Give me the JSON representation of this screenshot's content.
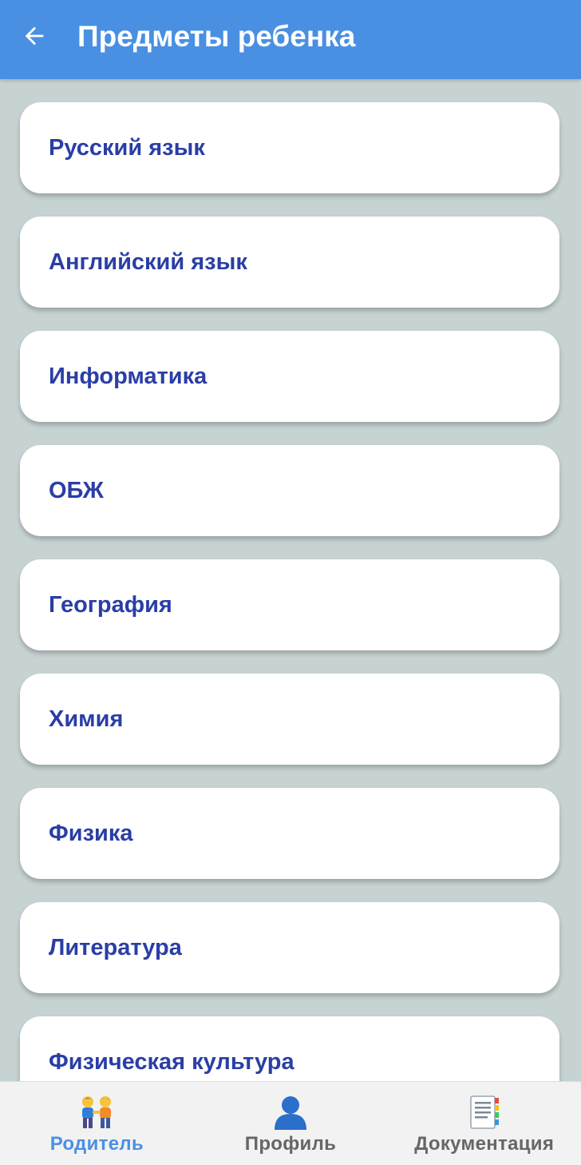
{
  "header": {
    "back_icon": "arrow-left-icon",
    "title": "Предметы ребенка"
  },
  "subjects": [
    {
      "label": "Русский язык"
    },
    {
      "label": "Английский язык"
    },
    {
      "label": "Информатика"
    },
    {
      "label": "ОБЖ"
    },
    {
      "label": "География"
    },
    {
      "label": "Химия"
    },
    {
      "label": "Физика"
    },
    {
      "label": "Литература"
    },
    {
      "label": "Физическая культура"
    }
  ],
  "bottom_nav": {
    "items": [
      {
        "label": "Родитель",
        "icon": "parent-children-icon",
        "active": true
      },
      {
        "label": "Профиль",
        "icon": "profile-icon",
        "active": false
      },
      {
        "label": "Документация",
        "icon": "documentation-icon",
        "active": false
      }
    ]
  },
  "colors": {
    "app_bar": "#4a90e2",
    "background": "#c7d3d3",
    "card_text": "#2a3ea6",
    "nav_active": "#4a90e2",
    "nav_inactive": "#666666"
  }
}
